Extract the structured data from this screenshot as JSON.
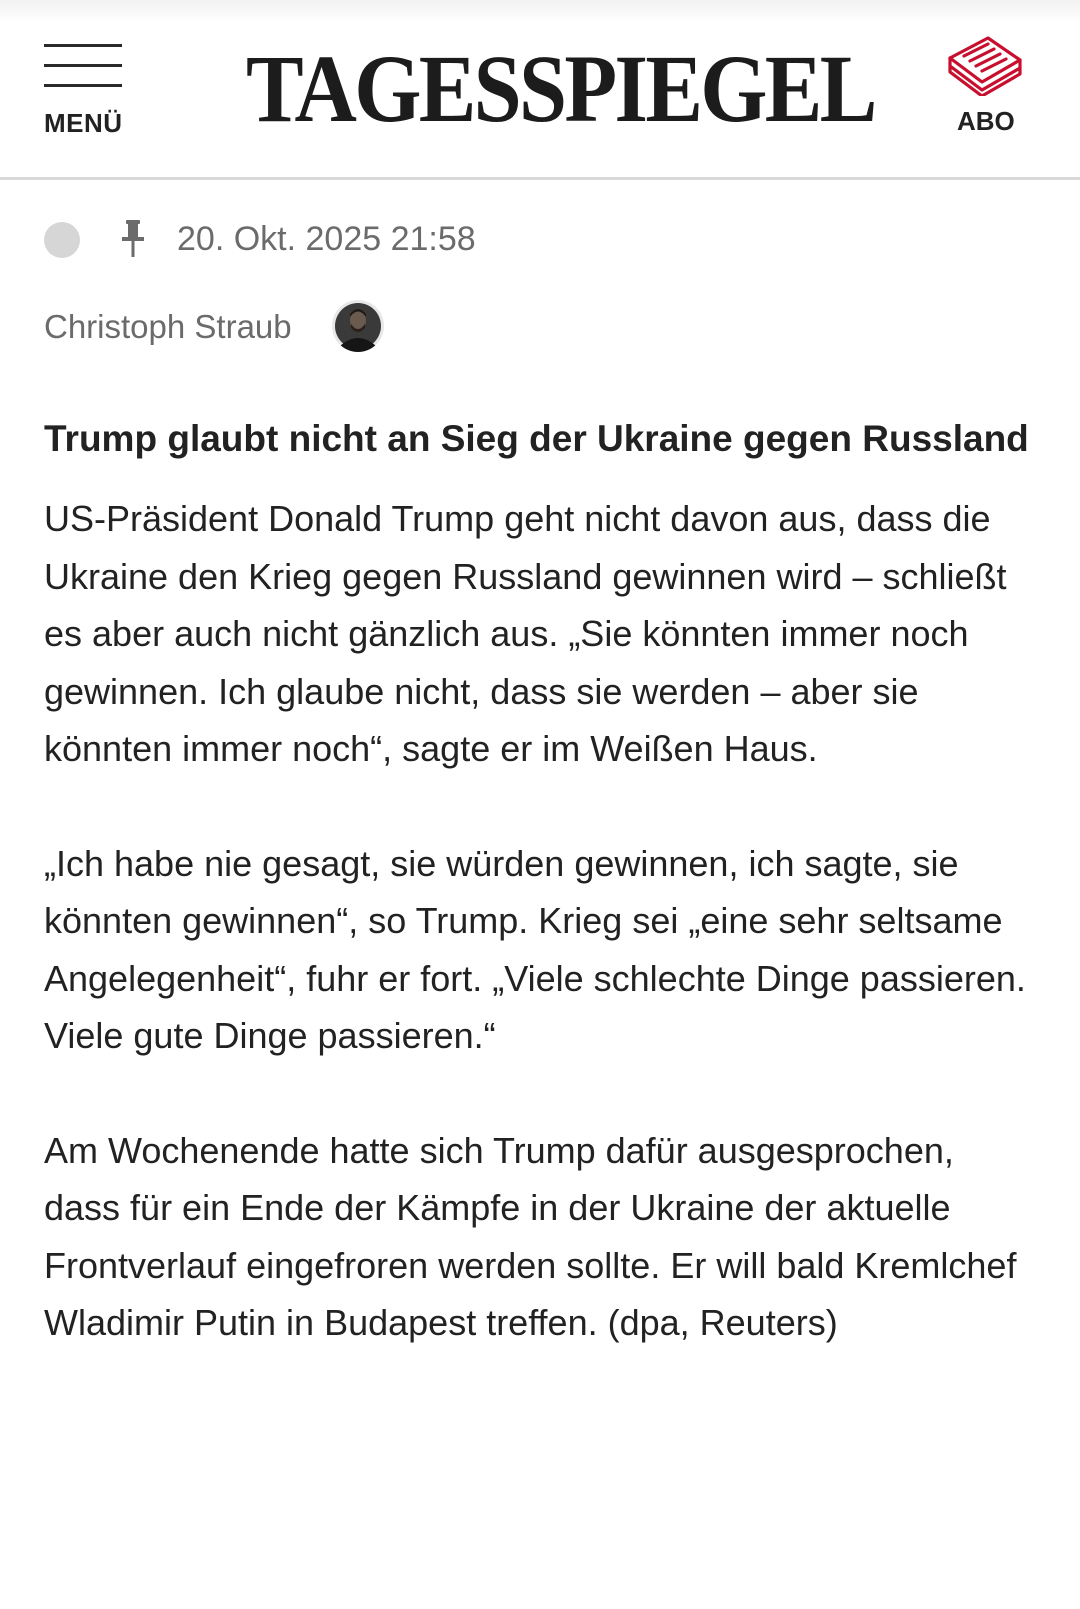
{
  "header": {
    "menu_label": "MENÜ",
    "logo_text": "TAGESSPIEGEL",
    "abo_label": "ABO",
    "brand_color": "#c8102e"
  },
  "meta": {
    "timestamp": "20. Okt. 2025 21:58",
    "author": "Christoph Straub"
  },
  "article": {
    "headline": "Trump glaubt nicht an Sieg der Ukraine gegen Russland",
    "paragraphs": [
      "US-Präsident Donald Trump geht nicht davon aus, dass die Ukraine den Krieg gegen Russland gewinnen wird –  schließt es aber auch nicht gänzlich aus. „Sie könnten immer noch gewinnen. Ich glaube nicht, dass sie werden – aber sie könnten immer noch“, sagte er im Weißen Haus.",
      "„Ich habe nie gesagt, sie würden gewinnen, ich sagte, sie könnten gewinnen“, so Trump. Krieg sei „eine sehr seltsame Angelegenheit“, fuhr er fort. „Viele schlechte Dinge passieren. Viele gute Dinge passieren.“",
      "Am Wochenende hatte sich Trump dafür ausgesprochen, dass für ein Ende der Kämpfe in der Ukraine der aktuelle Frontverlauf eingefroren werden sollte. Er will bald Kremlchef Wladimir Putin in Budapest treffen. (dpa, Reuters)"
    ]
  }
}
